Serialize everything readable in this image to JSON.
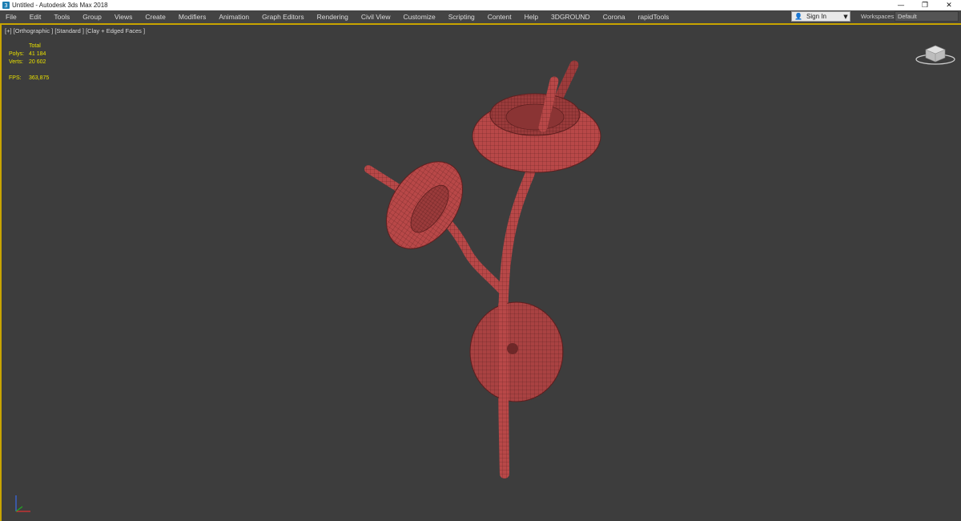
{
  "window": {
    "title": "Untitled - Autodesk 3ds Max 2018",
    "controls": [
      "—",
      "❐",
      "✕"
    ]
  },
  "menu": {
    "items": [
      "File",
      "Edit",
      "Tools",
      "Group",
      "Views",
      "Create",
      "Modifiers",
      "Animation",
      "Graph Editors",
      "Rendering",
      "Civil View",
      "Customize",
      "Scripting",
      "Content",
      "Help",
      "3DGROUND",
      "Corona",
      "rapidTools"
    ]
  },
  "signin": {
    "label": "Sign In"
  },
  "workspaces": {
    "label": "Workspaces:",
    "value": "Default"
  },
  "viewport": {
    "label": "[+] [Orthographic ] [Standard ] [Clay + Edged Faces ]",
    "stats": {
      "header": "Total",
      "polys_label": "Polys:",
      "polys_value": "41 184",
      "verts_label": "Verts:",
      "verts_value": "20 602",
      "fps_label": "FPS:",
      "fps_value": "363,875"
    }
  },
  "colors": {
    "accent": "#c8a400",
    "viewport_bg": "#3d3d3d",
    "model": "#b84848",
    "stats_text": "#e8e000"
  }
}
